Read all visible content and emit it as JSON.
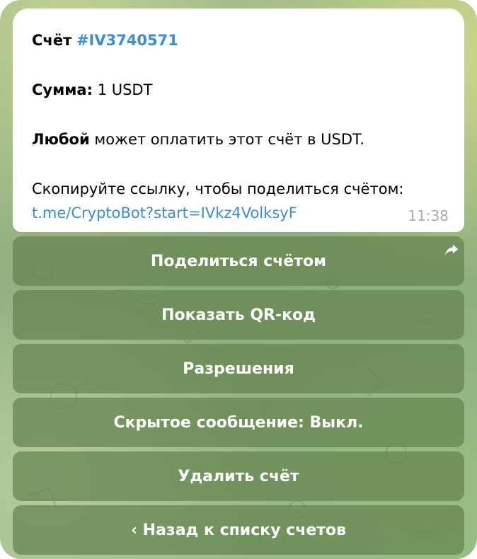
{
  "message": {
    "invoice_label": "Счёт",
    "invoice_id": "#IV3740571",
    "amount_label": "Сумма:",
    "amount_value": "1 USDT",
    "anyone_bold": "Любой",
    "anyone_rest": "может оплатить этот счёт в USDT.",
    "copy_text": "Скопируйте ссылку, чтобы поделиться счётом:",
    "link": "t.me/CryptoBot?start=IVkz4VolksyF",
    "time": "11:38"
  },
  "keyboard": {
    "buttons": [
      "Поделиться счётом",
      "Показать QR-код",
      "Разрешения",
      "Скрытое сообщение: Выкл.",
      "Удалить счёт",
      "‹ Назад к списку счетов"
    ]
  },
  "colors": {
    "link": "#3a8ed3",
    "button_bg": "#64844e",
    "bubble_bg": "#ffffff"
  },
  "icons": {
    "share": "share-arrow-icon"
  }
}
